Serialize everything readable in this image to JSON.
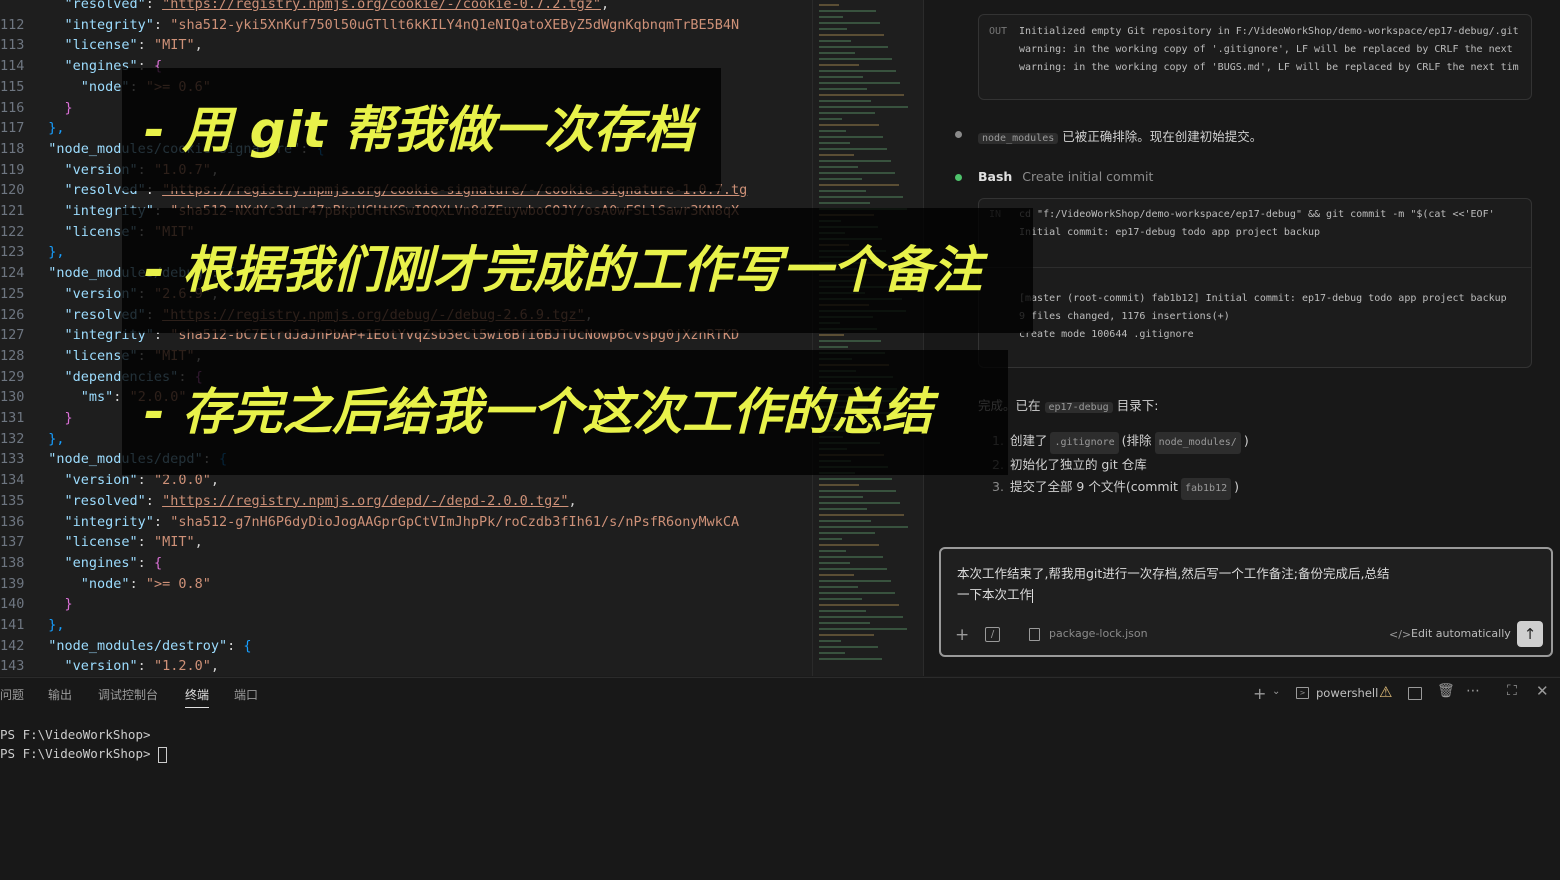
{
  "editor": {
    "lines": [
      {
        "n": "",
        "parts": [
          [
            "    ",
            "p"
          ],
          [
            "\"resolved\"",
            "k"
          ],
          [
            ": ",
            "p"
          ],
          [
            "\"https://registry.npmjs.org/cookie/-/cookie-0.7.2.tgz\"",
            "u"
          ],
          [
            ",",
            "p"
          ]
        ]
      },
      {
        "n": "112",
        "parts": [
          [
            "    ",
            "p"
          ],
          [
            "\"integrity\"",
            "k"
          ],
          [
            ": ",
            "p"
          ],
          [
            "\"sha512-yki5XnKuf750l50uGTllt6kKILY4nQ1eNIQatoXEByZ5dWgnKqbnqmTrBE5B4N",
            "s"
          ]
        ]
      },
      {
        "n": "113",
        "parts": [
          [
            "    ",
            "p"
          ],
          [
            "\"license\"",
            "k"
          ],
          [
            ": ",
            "p"
          ],
          [
            "\"MIT\"",
            "s"
          ],
          [
            ",",
            "p"
          ]
        ]
      },
      {
        "n": "114",
        "parts": [
          [
            "    ",
            "p"
          ],
          [
            "\"engines\"",
            "k"
          ],
          [
            ": ",
            "p"
          ],
          [
            "{",
            "b2"
          ]
        ]
      },
      {
        "n": "115",
        "parts": [
          [
            "      ",
            "p"
          ],
          [
            "\"node\"",
            "k"
          ],
          [
            ": ",
            "p"
          ],
          [
            "\">= 0.6\"",
            "s"
          ]
        ]
      },
      {
        "n": "116",
        "parts": [
          [
            "    ",
            "p"
          ],
          [
            "}",
            "b2"
          ]
        ]
      },
      {
        "n": "117",
        "parts": [
          [
            "  ",
            "p"
          ],
          [
            "},",
            "b3"
          ]
        ]
      },
      {
        "n": "118",
        "parts": [
          [
            "  ",
            "p"
          ],
          [
            "\"node_modules/cookie-signature\"",
            "k"
          ],
          [
            ": ",
            "p"
          ],
          [
            "{",
            "b3"
          ]
        ]
      },
      {
        "n": "119",
        "parts": [
          [
            "    ",
            "p"
          ],
          [
            "\"version\"",
            "k"
          ],
          [
            ": ",
            "p"
          ],
          [
            "\"1.0.7\"",
            "s"
          ],
          [
            ",",
            "p"
          ]
        ]
      },
      {
        "n": "120",
        "parts": [
          [
            "    ",
            "p"
          ],
          [
            "\"resolved\"",
            "k"
          ],
          [
            ": ",
            "p"
          ],
          [
            "\"https://registry.npmjs.org/cookie-signature/-/cookie-signature-1.0.7.tg",
            "u"
          ]
        ]
      },
      {
        "n": "121",
        "parts": [
          [
            "    ",
            "p"
          ],
          [
            "\"integrity\"",
            "k"
          ],
          [
            ": ",
            "p"
          ],
          [
            "\"sha512-NXdYc3dLr47pBkpUCHtKSwIOQXLVn8dZEuywboCOJY/osA0wFSLlSawr3KN8qX",
            "s"
          ]
        ]
      },
      {
        "n": "122",
        "parts": [
          [
            "    ",
            "p"
          ],
          [
            "\"license\"",
            "k"
          ],
          [
            ": ",
            "p"
          ],
          [
            "\"MIT\"",
            "s"
          ]
        ]
      },
      {
        "n": "123",
        "parts": [
          [
            "  ",
            "p"
          ],
          [
            "},",
            "b3"
          ]
        ]
      },
      {
        "n": "124",
        "parts": [
          [
            "  ",
            "p"
          ],
          [
            "\"node_modules/debug\"",
            "k"
          ],
          [
            ": ",
            "p"
          ],
          [
            "{",
            "b3"
          ]
        ]
      },
      {
        "n": "125",
        "parts": [
          [
            "    ",
            "p"
          ],
          [
            "\"version\"",
            "k"
          ],
          [
            ": ",
            "p"
          ],
          [
            "\"2.6.9\"",
            "s"
          ],
          [
            ",",
            "p"
          ]
        ]
      },
      {
        "n": "126",
        "parts": [
          [
            "    ",
            "p"
          ],
          [
            "\"resolved\"",
            "k"
          ],
          [
            ": ",
            "p"
          ],
          [
            "\"https://registry.npmjs.org/debug/-/debug-2.6.9.tgz\"",
            "u"
          ],
          [
            ",",
            "p"
          ]
        ]
      },
      {
        "n": "127",
        "parts": [
          [
            "    ",
            "p"
          ],
          [
            "\"integrity\"",
            "k"
          ],
          [
            ": ",
            "p"
          ],
          [
            "\"sha512-bC7ElrdJaJnPbAP+1EotYvqZsb3ecl5wi6Bfi6BJTUcNowp6cvspg0jXznRTKD",
            "s"
          ]
        ]
      },
      {
        "n": "128",
        "parts": [
          [
            "    ",
            "p"
          ],
          [
            "\"license\"",
            "k"
          ],
          [
            ": ",
            "p"
          ],
          [
            "\"MIT\"",
            "s"
          ],
          [
            ",",
            "p"
          ]
        ]
      },
      {
        "n": "129",
        "parts": [
          [
            "    ",
            "p"
          ],
          [
            "\"dependencies\"",
            "k"
          ],
          [
            ": ",
            "p"
          ],
          [
            "{",
            "b2"
          ]
        ]
      },
      {
        "n": "130",
        "parts": [
          [
            "      ",
            "p"
          ],
          [
            "\"ms\"",
            "k"
          ],
          [
            ": ",
            "p"
          ],
          [
            "\"2.0.0\"",
            "s"
          ]
        ]
      },
      {
        "n": "131",
        "parts": [
          [
            "    ",
            "p"
          ],
          [
            "}",
            "b2"
          ]
        ]
      },
      {
        "n": "132",
        "parts": [
          [
            "  ",
            "p"
          ],
          [
            "},",
            "b3"
          ]
        ]
      },
      {
        "n": "133",
        "parts": [
          [
            "  ",
            "p"
          ],
          [
            "\"node_modules/depd\"",
            "k"
          ],
          [
            ": ",
            "p"
          ],
          [
            "{",
            "b3"
          ]
        ]
      },
      {
        "n": "134",
        "parts": [
          [
            "    ",
            "p"
          ],
          [
            "\"version\"",
            "k"
          ],
          [
            ": ",
            "p"
          ],
          [
            "\"2.0.0\"",
            "s"
          ],
          [
            ",",
            "p"
          ]
        ]
      },
      {
        "n": "135",
        "parts": [
          [
            "    ",
            "p"
          ],
          [
            "\"resolved\"",
            "k"
          ],
          [
            ": ",
            "p"
          ],
          [
            "\"https://registry.npmjs.org/depd/-/depd-2.0.0.tgz\"",
            "u"
          ],
          [
            ",",
            "p"
          ]
        ]
      },
      {
        "n": "136",
        "parts": [
          [
            "    ",
            "p"
          ],
          [
            "\"integrity\"",
            "k"
          ],
          [
            ": ",
            "p"
          ],
          [
            "\"sha512-g7nH6P6dyDioJogAAGprGpCtVImJhpPk/roCzdb3fIh61/s/nPsfR6onyMwkCA",
            "s"
          ]
        ]
      },
      {
        "n": "137",
        "parts": [
          [
            "    ",
            "p"
          ],
          [
            "\"license\"",
            "k"
          ],
          [
            ": ",
            "p"
          ],
          [
            "\"MIT\"",
            "s"
          ],
          [
            ",",
            "p"
          ]
        ]
      },
      {
        "n": "138",
        "parts": [
          [
            "    ",
            "p"
          ],
          [
            "\"engines\"",
            "k"
          ],
          [
            ": ",
            "p"
          ],
          [
            "{",
            "b2"
          ]
        ]
      },
      {
        "n": "139",
        "parts": [
          [
            "      ",
            "p"
          ],
          [
            "\"node\"",
            "k"
          ],
          [
            ": ",
            "p"
          ],
          [
            "\">= 0.8\"",
            "s"
          ]
        ]
      },
      {
        "n": "140",
        "parts": [
          [
            "    ",
            "p"
          ],
          [
            "}",
            "b2"
          ]
        ]
      },
      {
        "n": "141",
        "parts": [
          [
            "  ",
            "p"
          ],
          [
            "},",
            "b3"
          ]
        ]
      },
      {
        "n": "142",
        "parts": [
          [
            "  ",
            "p"
          ],
          [
            "\"node_modules/destroy\"",
            "k"
          ],
          [
            ": ",
            "p"
          ],
          [
            "{",
            "b3"
          ]
        ]
      },
      {
        "n": "143",
        "parts": [
          [
            "    ",
            "p"
          ],
          [
            "\"version\"",
            "k"
          ],
          [
            ": ",
            "p"
          ],
          [
            "\"1.2.0\"",
            "s"
          ],
          [
            ",",
            "p"
          ]
        ]
      }
    ]
  },
  "chat": {
    "out_label": "OUT",
    "out_lines": [
      "Initialized empty Git repository in F:/VideoWorkShop/demo-workspace/ep17-debug/.git",
      "warning: in the working copy of '.gitignore', LF will be replaced by CRLF the next",
      "warning: in the working copy of 'BUGS.md', LF will be replaced by CRLF the next tim"
    ],
    "msg1_tag": "node_modules",
    "msg1_text": "已被正确排除。现在创建初始提交。",
    "bash_label": "Bash",
    "bash_desc": "Create initial commit",
    "in_label": "IN",
    "cmd_lines": [
      "cd \"f:/VideoWorkShop/demo-workspace/ep17-debug\" && git commit -m \"$(cat <<'EOF'",
      "Initial commit: ep17-debug todo app project backup"
    ],
    "result_lines": [
      "[master (root-commit) fab1b12] Initial commit: ep17-debug todo app project backup",
      " 9 files changed, 1176 insertions(+)",
      " create mode 100644 .gitignore"
    ],
    "summary_prefix": "完成。已在",
    "summary_tag": "ep17-debug",
    "summary_suffix": "目录下:",
    "items": [
      {
        "num": "1.",
        "pre": "创建了",
        "tag": ".gitignore",
        "post": "(排除",
        "tag2": "node_modules/",
        "end": ")"
      },
      {
        "num": "2.",
        "pre": "初始化了独立的 git 仓库",
        "tag": "",
        "post": "",
        "tag2": "",
        "end": ""
      },
      {
        "num": "3.",
        "pre": "提交了全部 9 个文件(commit",
        "tag": "fab1b12",
        "post": ")",
        "tag2": "",
        "end": ""
      }
    ],
    "input_text_line1": "本次工作结束了,帮我用git进行一次存档,然后写一个工作备注;备份完成后,总结",
    "input_text_line2": "一下本次工作",
    "context_file": "package-lock.json",
    "edit_mode": "Edit automatically"
  },
  "panel": {
    "tabs": [
      "问题",
      "输出",
      "调试控制台",
      "终端",
      "端口"
    ],
    "active_tab": "终端",
    "shell": "powershell",
    "terminal_lines": [
      "PS F:\\VideoWorkShop>",
      "PS F:\\VideoWorkShop> "
    ]
  },
  "overlay": {
    "lines": [
      "- 用 git 帮我做一次存档",
      "- 根据我们刚才完成的工作写一个备注",
      "- 存完之后给我一个这次工作的总结"
    ]
  },
  "colors": {
    "overlay_text": "#e8f24a",
    "dot_gray": "#8a8a8a",
    "dot_green": "#4ec26b",
    "warning": "#e5c07b"
  }
}
